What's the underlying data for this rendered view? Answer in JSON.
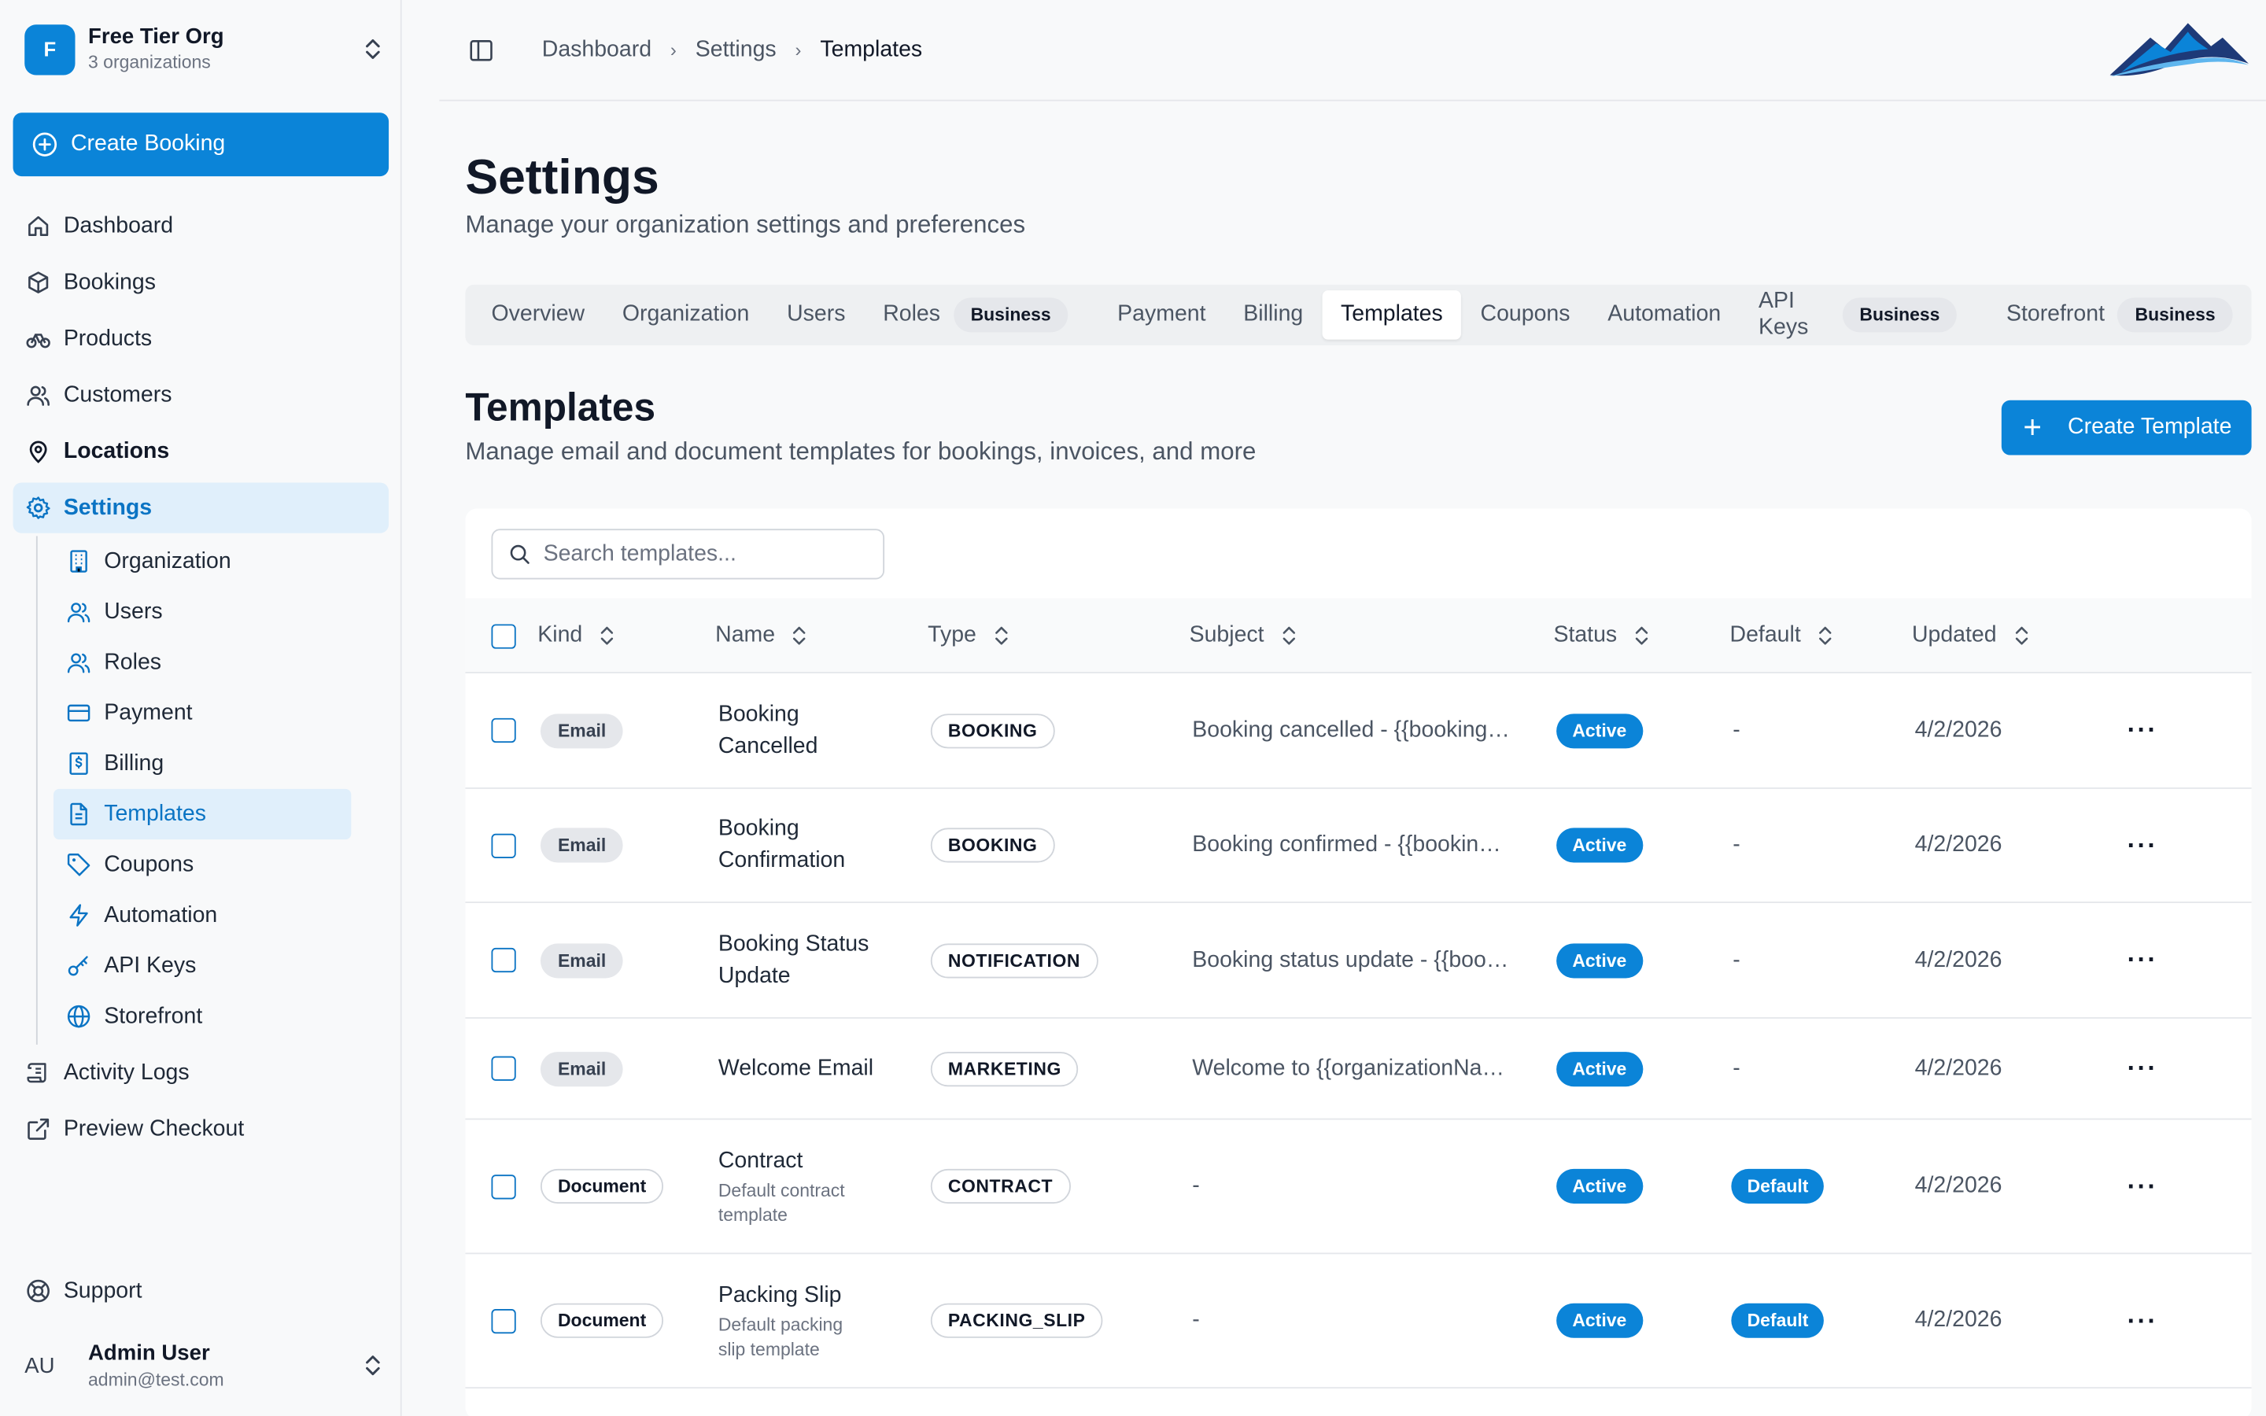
{
  "colors": {
    "accent": "#0b84d8",
    "accent_light": "#e0effb"
  },
  "sidebar": {
    "org_initial": "F",
    "org_name": "Free Tier Org",
    "org_sub": "3 organizations",
    "create_booking": "Create Booking",
    "items": [
      {
        "label": "Dashboard",
        "icon": "home-icon"
      },
      {
        "label": "Bookings",
        "icon": "box-icon"
      },
      {
        "label": "Products",
        "icon": "bike-icon"
      },
      {
        "label": "Customers",
        "icon": "users-icon"
      },
      {
        "label": "Locations",
        "icon": "map-pin-icon"
      },
      {
        "label": "Settings",
        "icon": "gear-icon"
      }
    ],
    "sub_items": [
      {
        "label": "Organization",
        "icon": "building-icon"
      },
      {
        "label": "Users",
        "icon": "users-icon"
      },
      {
        "label": "Roles",
        "icon": "users-icon"
      },
      {
        "label": "Payment",
        "icon": "credit-card-icon"
      },
      {
        "label": "Billing",
        "icon": "dollar-receipt-icon"
      },
      {
        "label": "Templates",
        "icon": "file-text-icon"
      },
      {
        "label": "Coupons",
        "icon": "tag-icon"
      },
      {
        "label": "Automation",
        "icon": "zap-icon"
      },
      {
        "label": "API Keys",
        "icon": "key-icon"
      },
      {
        "label": "Storefront",
        "icon": "globe-icon"
      }
    ],
    "after_items": [
      {
        "label": "Activity Logs",
        "icon": "scroll-icon"
      },
      {
        "label": "Preview Checkout",
        "icon": "external-link-icon"
      }
    ],
    "support": "Support",
    "user_initials": "AU",
    "user_name": "Admin User",
    "user_email": "admin@test.com"
  },
  "breadcrumb": [
    "Dashboard",
    "Settings",
    "Templates"
  ],
  "page": {
    "title": "Settings",
    "subtitle": "Manage your organization settings and preferences"
  },
  "tabs": [
    {
      "label": "Overview"
    },
    {
      "label": "Organization"
    },
    {
      "label": "Users"
    },
    {
      "label": "Roles",
      "badge": "Business"
    },
    {
      "label": "Payment"
    },
    {
      "label": "Billing"
    },
    {
      "label": "Templates",
      "active": true
    },
    {
      "label": "Coupons"
    },
    {
      "label": "Automation"
    },
    {
      "label": "API Keys",
      "badge": "Business"
    },
    {
      "label": "Storefront",
      "badge": "Business"
    }
  ],
  "section": {
    "title": "Templates",
    "subtitle": "Manage email and document templates for bookings, invoices, and more",
    "create_label": "Create Template"
  },
  "search": {
    "placeholder": "Search templates..."
  },
  "table": {
    "columns": [
      "Kind",
      "Name",
      "Type",
      "Subject",
      "Status",
      "Default",
      "Updated"
    ],
    "rows": [
      {
        "kind": "Email",
        "name_l1": "Booking",
        "name_l2": "Cancelled",
        "desc_l1": "",
        "desc_l2": "",
        "type": "BOOKING",
        "subject": "Booking cancelled - {{booking…",
        "status": "Active",
        "default": "-",
        "updated": "4/2/2026"
      },
      {
        "kind": "Email",
        "name_l1": "Booking",
        "name_l2": "Confirmation",
        "desc_l1": "",
        "desc_l2": "",
        "type": "BOOKING",
        "subject": "Booking confirmed - {{bookin…",
        "status": "Active",
        "default": "-",
        "updated": "4/2/2026"
      },
      {
        "kind": "Email",
        "name_l1": "Booking Status",
        "name_l2": "Update",
        "desc_l1": "",
        "desc_l2": "",
        "type": "NOTIFICATION",
        "subject": "Booking status update - {{boo…",
        "status": "Active",
        "default": "-",
        "updated": "4/2/2026"
      },
      {
        "kind": "Email",
        "name_l1": "Welcome Email",
        "name_l2": "",
        "desc_l1": "",
        "desc_l2": "",
        "type": "MARKETING",
        "subject": "Welcome to {{organizationNa…",
        "status": "Active",
        "default": "-",
        "updated": "4/2/2026"
      },
      {
        "kind": "Document",
        "name_l1": "Contract",
        "name_l2": "",
        "desc_l1": "Default contract",
        "desc_l2": "template",
        "type": "CONTRACT",
        "subject": "-",
        "status": "Active",
        "default": "Default",
        "updated": "4/2/2026"
      },
      {
        "kind": "Document",
        "name_l1": "Packing Slip",
        "name_l2": "",
        "desc_l1": "Default packing",
        "desc_l2": "slip template",
        "type": "PACKING_SLIP",
        "subject": "-",
        "status": "Active",
        "default": "Default",
        "updated": "4/2/2026"
      }
    ],
    "actions_label": "···"
  }
}
